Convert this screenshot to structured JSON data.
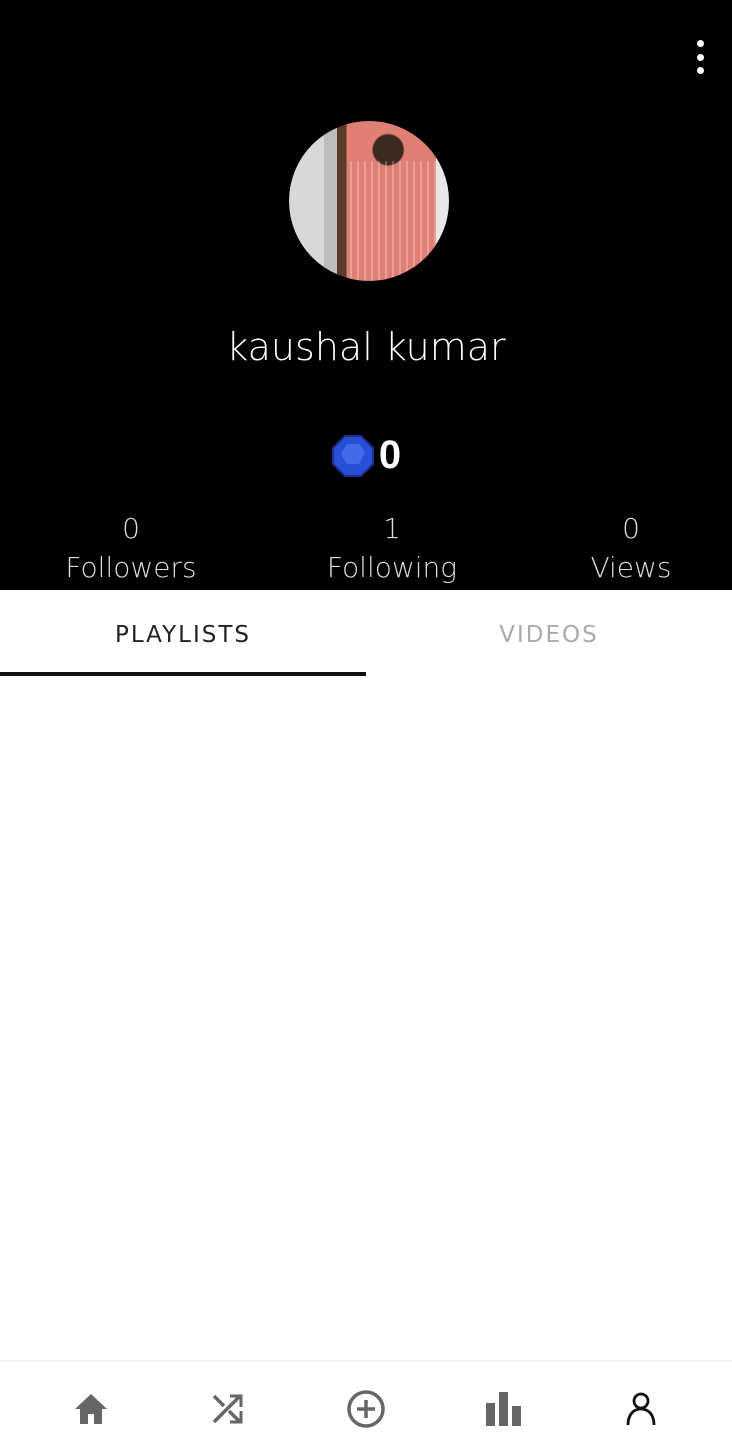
{
  "profile": {
    "name": "kaushal kumar",
    "gems": "0"
  },
  "stats": [
    {
      "value": "0",
      "label": "Followers"
    },
    {
      "value": "1",
      "label": "Following"
    },
    {
      "value": "0",
      "label": "Views"
    }
  ],
  "tabs": [
    {
      "label": "PLAYLISTS",
      "active": true
    },
    {
      "label": "VIDEOS",
      "active": false
    }
  ],
  "nav": [
    "home-icon",
    "shuffle-icon",
    "add-circle-icon",
    "leaderboard-icon",
    "profile-icon"
  ],
  "colors": {
    "header": "#000000",
    "icon": "#666666",
    "gem": "#2a4fd6"
  }
}
